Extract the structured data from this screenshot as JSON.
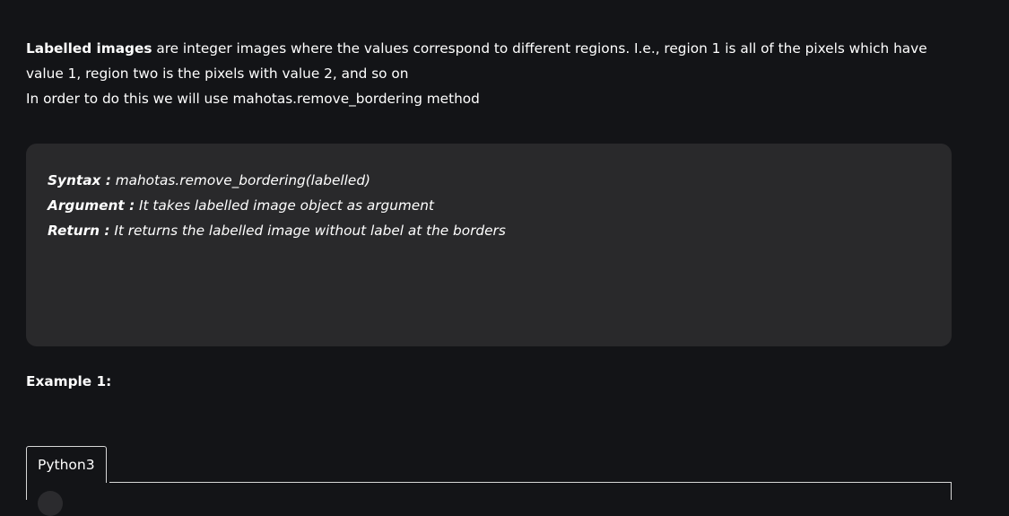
{
  "intro": {
    "term": "Labelled images",
    "definition": " are integer images where the values correspond to different regions. I.e., region 1 is all of the pixels which have value 1, region two is the pixels with value 2, and so on",
    "method_sentence": "In order to do this we will use mahotas.remove_bordering method"
  },
  "syntax": {
    "syntax_label": "Syntax :",
    "syntax_value": " mahotas.remove_bordering(labelled)",
    "argument_label": "Argument :",
    "argument_value": " It takes labelled image object as argument",
    "return_label": "Return :",
    "return_value": " It returns the labelled image without label at the borders"
  },
  "example": {
    "heading": "Example 1:"
  },
  "code": {
    "tabs": [
      {
        "label": "Python3"
      }
    ]
  }
}
